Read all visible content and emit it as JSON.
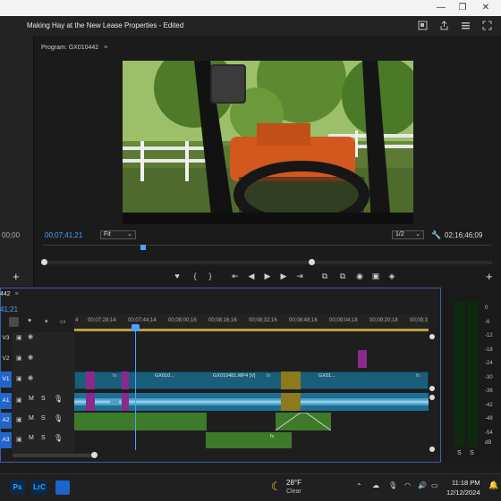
{
  "window": {
    "minimize": "—",
    "maximize": "❐",
    "close": "✕"
  },
  "header": {
    "title": "Making Hay at the New Lease Properties",
    "edited": " - Edited"
  },
  "program_monitor": {
    "tab_label": "Program: GX010442",
    "timecode_current": "00;07;41;21",
    "timecode_duration": "02;16;46;09",
    "fit_label": "Fit",
    "resolution_label": "1/2"
  },
  "left_panel": {
    "timecode": "00;00"
  },
  "timeline": {
    "tab_label": "442",
    "timecode": "41;21",
    "ruler_labels": [
      "4",
      "00;07;28;14",
      "00;07;44;14",
      "00;08;00;16",
      "00;08;16;16",
      "00;08;32;16",
      "00;08;48;16",
      "00;09;04;18",
      "00;09;20;18",
      "00;09;3"
    ],
    "tracks": [
      {
        "name": "V3"
      },
      {
        "name": "V2"
      },
      {
        "name": "V1"
      },
      {
        "name": "A1"
      },
      {
        "name": "A2"
      },
      {
        "name": "A3"
      }
    ],
    "track_m": "M",
    "track_s": "S",
    "clips": {
      "v1_a": "GX010...",
      "v1_b": "GX010481.MP4 [V]",
      "v1_c": "GX01...",
      "fx": "fx"
    }
  },
  "meter": {
    "labels": [
      "0",
      "-6",
      "-12",
      "-18",
      "-24",
      "-30",
      "-36",
      "-42",
      "-48",
      "-54",
      "dB"
    ],
    "solo_left": "S",
    "solo_right": "S"
  },
  "taskbar": {
    "apps": [
      "Ps",
      "LrC"
    ],
    "weather_temp": "28°F",
    "weather_cond": "Clear",
    "time": "11:18 PM",
    "date": "12/12/2024"
  },
  "colors": {
    "accent_blue": "#4aa3ff",
    "clip_video": "#1a5f7a",
    "clip_audio": "#1d6e94",
    "clip_magenta": "#8b2a8e",
    "clip_gold": "#8c7a1c",
    "clip_green": "#3d7a2a"
  }
}
